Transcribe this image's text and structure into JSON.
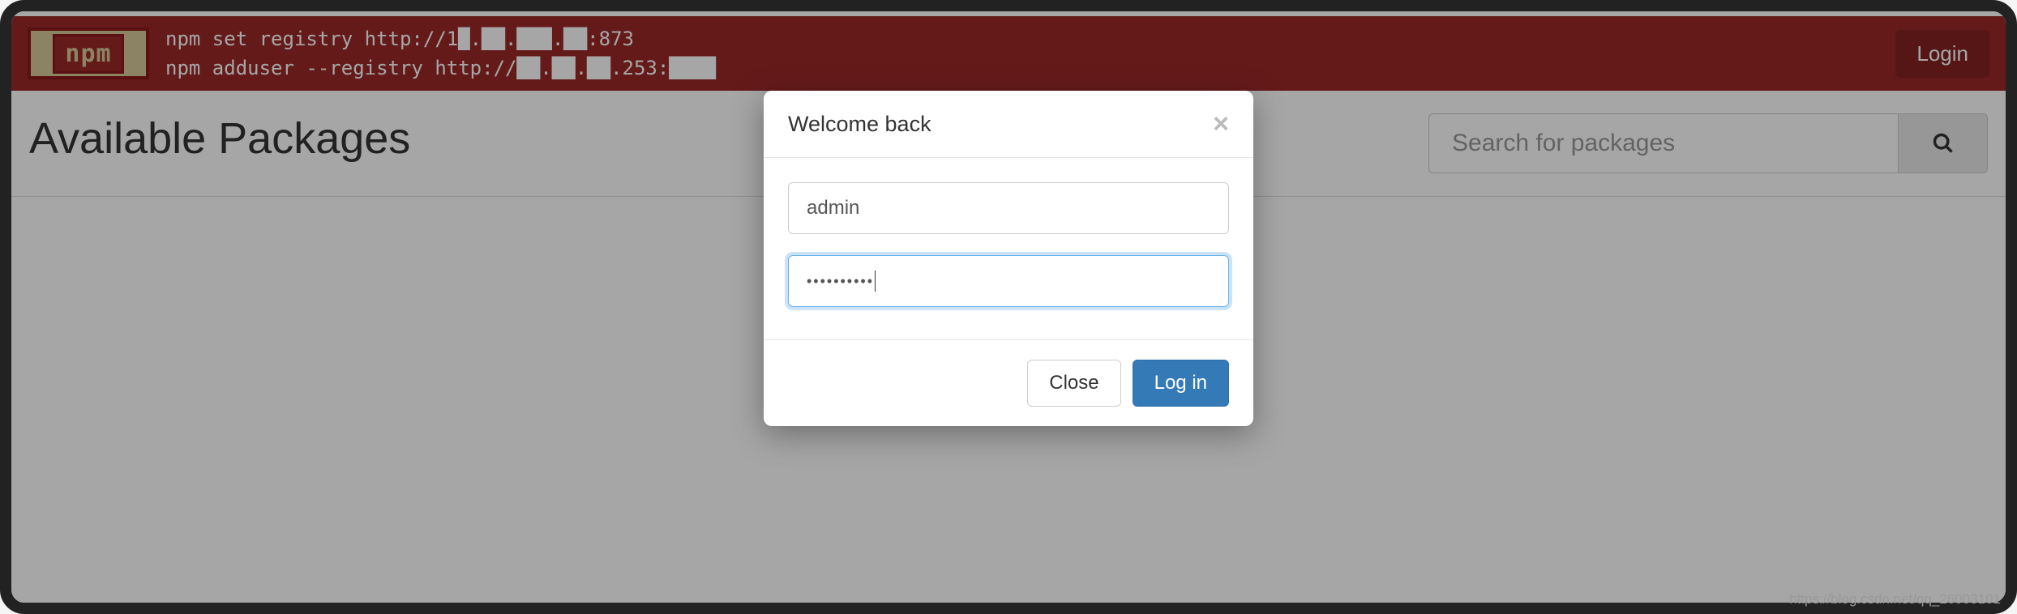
{
  "header": {
    "logo_text": "npm",
    "command_line1": "npm set registry http://1█.██.███.██:873",
    "command_line2": "npm adduser --registry http://██.██.██.253:████",
    "login_button": "Login"
  },
  "main": {
    "title": "Available Packages",
    "search_placeholder": "Search for packages"
  },
  "modal": {
    "title": "Welcome back",
    "username_value": "admin",
    "password_value": "••••••••••",
    "close_button": "Close",
    "login_button": "Log in"
  },
  "watermark": "https://blog.csdn.net/qq_26003101"
}
